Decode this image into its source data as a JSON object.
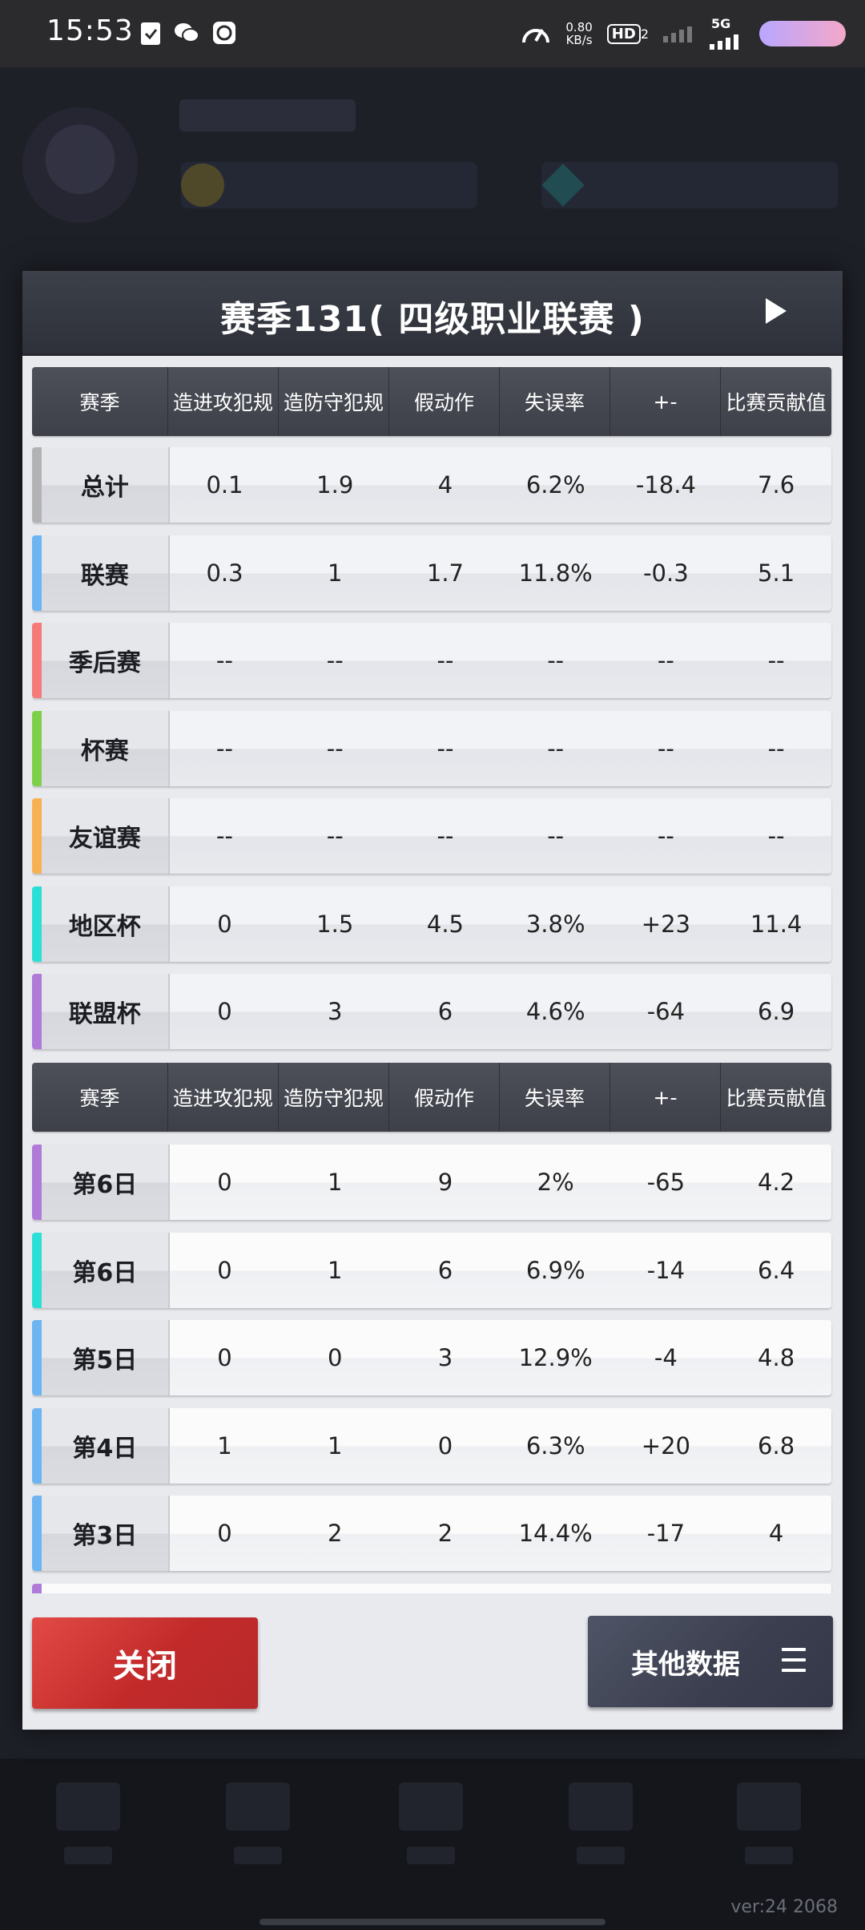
{
  "status": {
    "time": "15:53",
    "net_speed": "0.80",
    "net_unit": "KB/s",
    "hd": "HD",
    "hd_sub": "2",
    "network": "5G"
  },
  "modal": {
    "title": "赛季131( 四级职业联赛 )",
    "close_label": "关闭",
    "other_label": "其他数据"
  },
  "headers": [
    "赛季",
    "造进攻犯规",
    "造防守犯规",
    "假动作",
    "失误率",
    "+-",
    "比赛贡献值"
  ],
  "season_rows": [
    {
      "name": "总计",
      "color": "#b3b3b6",
      "values": [
        "0.1",
        "1.9",
        "4",
        "6.2%",
        "-18.4",
        "7.6"
      ]
    },
    {
      "name": "联赛",
      "color": "#6cb4f2",
      "values": [
        "0.3",
        "1",
        "1.7",
        "11.8%",
        "-0.3",
        "5.1"
      ]
    },
    {
      "name": "季后赛",
      "color": "#f57a7a",
      "values": [
        "--",
        "--",
        "--",
        "--",
        "--",
        "--"
      ]
    },
    {
      "name": "杯赛",
      "color": "#7ed04a",
      "values": [
        "--",
        "--",
        "--",
        "--",
        "--",
        "--"
      ]
    },
    {
      "name": "友谊赛",
      "color": "#f6b152",
      "values": [
        "--",
        "--",
        "--",
        "--",
        "--",
        "--"
      ]
    },
    {
      "name": "地区杯",
      "color": "#2adfd5",
      "values": [
        "0",
        "1.5",
        "4.5",
        "3.8%",
        "+23",
        "11.4"
      ]
    },
    {
      "name": "联盟杯",
      "color": "#b07ad9",
      "values": [
        "0",
        "3",
        "6",
        "4.6%",
        "-64",
        "6.9"
      ]
    }
  ],
  "game_rows": [
    {
      "name": "第6日",
      "color": "#b07ad9",
      "values": [
        "0",
        "1",
        "9",
        "2%",
        "-65",
        "4.2"
      ]
    },
    {
      "name": "第6日",
      "color": "#2adfd5",
      "values": [
        "0",
        "1",
        "6",
        "6.9%",
        "-14",
        "6.4"
      ]
    },
    {
      "name": "第5日",
      "color": "#6cb4f2",
      "values": [
        "0",
        "0",
        "3",
        "12.9%",
        "-4",
        "4.8"
      ]
    },
    {
      "name": "第4日",
      "color": "#6cb4f2",
      "values": [
        "1",
        "1",
        "0",
        "6.3%",
        "+20",
        "6.8"
      ]
    },
    {
      "name": "第3日",
      "color": "#6cb4f2",
      "values": [
        "0",
        "2",
        "2",
        "14.4%",
        "-17",
        "4"
      ]
    }
  ],
  "partial_row_color": "#b07ad9",
  "version": "ver:24   2068"
}
